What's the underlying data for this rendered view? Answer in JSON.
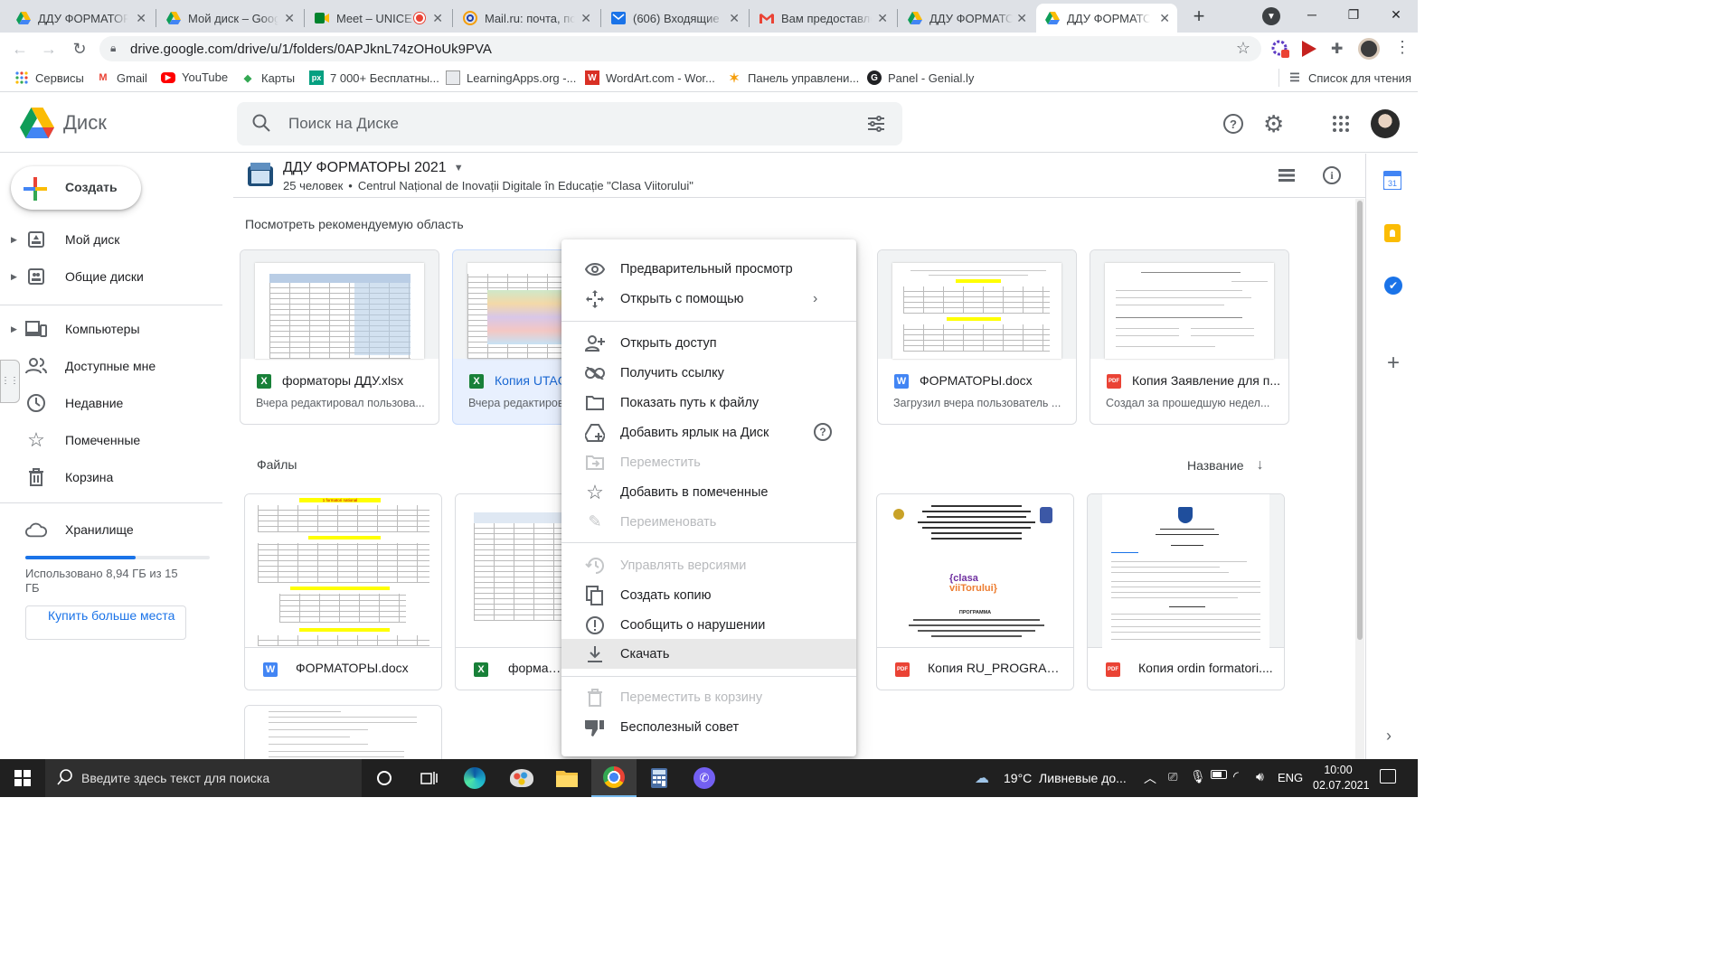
{
  "browser": {
    "tabs": [
      {
        "label": "ДДУ ФОРМАТОРЫ",
        "icon": "google-drive-icon"
      },
      {
        "label": "Мой диск – Goog",
        "icon": "google-drive-icon"
      },
      {
        "label": "Meet – UNICE",
        "icon": "google-meet-icon"
      },
      {
        "label": "Mail.ru: почта, по",
        "icon": "mailru-icon"
      },
      {
        "label": "(606) Входящие -",
        "icon": "mail-icon"
      },
      {
        "label": "Вам предоставле",
        "icon": "gmail-icon"
      },
      {
        "label": "ДДУ ФОРМАТОР",
        "icon": "google-drive-icon"
      },
      {
        "label": "ДДУ ФОРМАТОР",
        "icon": "google-drive-icon"
      }
    ],
    "new_tab": "+",
    "url": "drive.google.com/drive/u/1/folders/0APJknL74zOHoUk9PVA",
    "bookmarks": [
      {
        "label": "Сервисы",
        "icon": "apps-grid-icon"
      },
      {
        "label": "Gmail",
        "icon": "gmail-icon"
      },
      {
        "label": "YouTube",
        "icon": "youtube-icon"
      },
      {
        "label": "Карты",
        "icon": "maps-icon"
      },
      {
        "label": "7 000+ Бесплатны...",
        "icon": "px-icon"
      },
      {
        "label": "LearningApps.org -...",
        "icon": "learningapps-icon"
      },
      {
        "label": "WordArt.com - Wor...",
        "icon": "wordart-icon"
      },
      {
        "label": "Панель управлени...",
        "icon": "panel-icon"
      },
      {
        "label": "Panel - Genial.ly",
        "icon": "genially-icon"
      }
    ],
    "reading_list": "Список для чтения"
  },
  "drive": {
    "app_name": "Диск",
    "search_placeholder": "Поиск на Диске",
    "create_label": "Создать",
    "nav": [
      {
        "label": "Мой диск",
        "icon": "my-drive-icon"
      },
      {
        "label": "Общие диски",
        "icon": "shared-drives-icon"
      },
      {
        "label": "Компьютеры",
        "icon": "computers-icon"
      },
      {
        "label": "Доступные мне",
        "icon": "shared-with-me-icon"
      },
      {
        "label": "Недавние",
        "icon": "recent-icon"
      },
      {
        "label": "Помеченные",
        "icon": "starred-icon"
      },
      {
        "label": "Корзина",
        "icon": "trash-icon"
      }
    ],
    "storage": {
      "label": "Хранилище",
      "used_text": "Использовано 8,94 ГБ из 15 ГБ",
      "used_fraction": 0.596,
      "buy_label": "Купить больше места"
    },
    "folder": {
      "title": "ДДУ ФОРМАТОРЫ 2021",
      "members": "25 человек",
      "org": "Centrul Național de Inovații Digitale în Educație \"Clasa Viitorului\""
    },
    "suggested_label": "Посмотреть рекомендуемую область",
    "suggested": [
      {
        "name": "форматоры ДДУ.xlsx",
        "sub": "Вчера редактировал пользова...",
        "type": "x"
      },
      {
        "name": "Копия UTAG",
        "sub": "Вчера редактиров",
        "type": "x"
      },
      {
        "name": "ФОРМАТОРЫ.docx",
        "sub": "Загрузил вчера пользователь ...",
        "type": "w"
      },
      {
        "name": "Копия Заявление для п...",
        "sub": "Создал за прошедшую недел...",
        "type": "pdf"
      }
    ],
    "files_label": "Файлы",
    "sort_label": "Название",
    "files": [
      {
        "name": "ФОРМАТОРЫ.docx",
        "type": "w"
      },
      {
        "name": "форматор",
        "type": "x"
      },
      {
        "name": "Копия RU_PROGRAM ...",
        "type": "pdf"
      },
      {
        "name": "Копия ordin formatori....",
        "type": "pdf"
      }
    ],
    "thumb_text": {
      "doc1_heading": "1 formatori national",
      "clasa_logo_line1": "{clasa",
      "clasa_logo_line2": "viiTorului}",
      "program_label": "ПРОГРАММА"
    }
  },
  "context_menu": {
    "items": [
      {
        "label": "Предварительный просмотр",
        "icon": "eye-icon",
        "disabled": false
      },
      {
        "label": "Открыть с помощью",
        "icon": "open-with-icon",
        "disabled": false
      },
      {
        "label": "Открыть доступ",
        "icon": "person-add-icon",
        "disabled": false
      },
      {
        "label": "Получить ссылку",
        "icon": "link-icon",
        "disabled": false
      },
      {
        "label": "Показать путь к файлу",
        "icon": "folder-icon",
        "disabled": false
      },
      {
        "label": "Добавить ярлык на Диск",
        "icon": "add-shortcut-icon",
        "disabled": false
      },
      {
        "label": "Переместить",
        "icon": "move-icon",
        "disabled": true
      },
      {
        "label": "Добавить в помеченные",
        "icon": "star-icon",
        "disabled": false
      },
      {
        "label": "Переименовать",
        "icon": "pencil-icon",
        "disabled": true
      },
      {
        "label": "Управлять версиями",
        "icon": "history-icon",
        "disabled": true
      },
      {
        "label": "Создать копию",
        "icon": "copy-icon",
        "disabled": false
      },
      {
        "label": "Сообщить о нарушении",
        "icon": "report-icon",
        "disabled": false
      },
      {
        "label": "Скачать",
        "icon": "download-icon",
        "disabled": false
      },
      {
        "label": "Переместить в корзину",
        "icon": "trash-icon",
        "disabled": true
      },
      {
        "label": "Бесполезный совет",
        "icon": "thumb-down-icon",
        "disabled": false
      }
    ]
  },
  "taskbar": {
    "search_placeholder": "Введите здесь текст для поиска",
    "weather": "19°C  Ливневые до...",
    "lang": "ENG",
    "time": "10:00",
    "date": "02.07.2021"
  },
  "colors": {
    "drive_blue": "#1a73e8",
    "highlight": "#e8e8e8",
    "taskbar": "#202020"
  }
}
